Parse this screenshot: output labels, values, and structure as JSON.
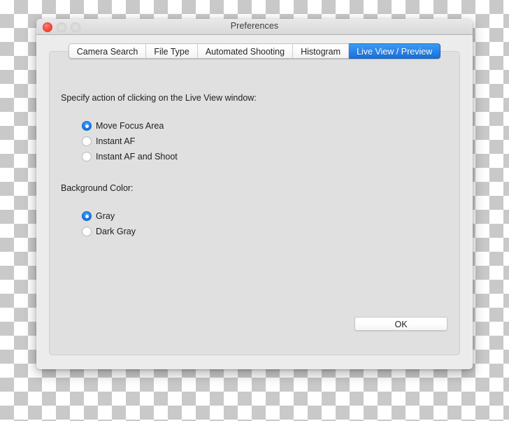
{
  "window": {
    "title": "Preferences",
    "controls": {
      "close": "close-button",
      "minimize": "minimize-button",
      "zoom": "zoom-button"
    }
  },
  "tabs": [
    {
      "label": "Camera Search",
      "active": false
    },
    {
      "label": "File Type",
      "active": false
    },
    {
      "label": "Automated Shooting",
      "active": false
    },
    {
      "label": "Histogram",
      "active": false
    },
    {
      "label": "Live View / Preview",
      "active": true
    }
  ],
  "content": {
    "live_view_section": {
      "label": "Specify action of clicking on the Live View window:",
      "options": [
        {
          "label": "Move Focus Area",
          "selected": true
        },
        {
          "label": "Instant AF",
          "selected": false
        },
        {
          "label": "Instant AF and Shoot",
          "selected": false
        }
      ]
    },
    "background_color_section": {
      "label": "Background Color:",
      "options": [
        {
          "label": "Gray",
          "selected": true
        },
        {
          "label": "Dark Gray",
          "selected": false
        }
      ]
    }
  },
  "footer": {
    "ok_label": "OK"
  },
  "colors": {
    "accent_blue": "#1a7ee8",
    "active_tab_blue": "#2a86ec",
    "close_red": "#f6483c",
    "panel_gray": "#e0e0e0",
    "window_gray": "#ececec"
  }
}
